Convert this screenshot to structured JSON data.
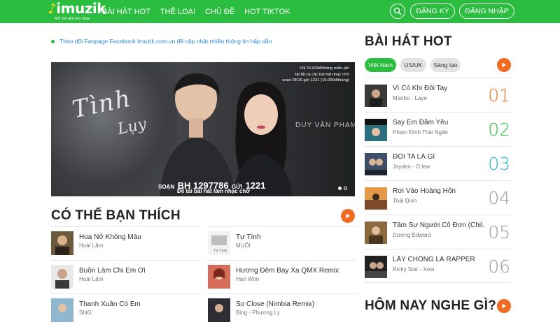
{
  "header": {
    "logo": {
      "word": "imuzik",
      "tagline": "Mở thế giới âm nhạc"
    },
    "nav": [
      "BÀI HÁT HOT",
      "THỂ LOẠI",
      "CHỦ ĐỀ",
      "HOT TIKTOK"
    ],
    "search_icon": "search-icon",
    "register_label": "ĐĂNG KÝ",
    "login_label": "ĐĂNG NHẬP",
    "brand_color": "#2bbd3f"
  },
  "notice": "Theo dõi Fanpage Facebook Imuzik.com.vn để cập nhật nhiều thông tin hấp dẫn",
  "banner": {
    "info_lines": [
      "Chỉ 15.000đ/tháng miễn phí",
      "tải tất cả các bài hát nhạc chờ",
      "soạn DK15 gửi 1221 (15.000đ/tháng)"
    ],
    "script_title_1": "Tình",
    "script_title_2": "Lụy",
    "artist": "DUY VĂN PHẠM",
    "sms_prefix": "SOẠN",
    "sms_code": "BH 1297786",
    "sms_mid": "GỬI",
    "sms_number": "1221",
    "sms_sub": "Để tải bài hát làm nhạc chờ"
  },
  "you_may_like": {
    "title": "CÓ THỂ BẠN THÍCH",
    "left": [
      {
        "title": "Hoa Nở Không Màu",
        "artist": "Hoài Lâm"
      },
      {
        "title": "Buồn Làm Chi Em Ơi",
        "artist": "Hoài Lâm"
      },
      {
        "title": "Thanh Xuân Có Em",
        "artist": "ShiG"
      }
    ],
    "right": [
      {
        "title": "Tự Tình",
        "artist": "MUỐI"
      },
      {
        "title": "Hương Đêm Bay Xa QMX Remix",
        "artist": "Hari Won"
      },
      {
        "title": "So Close (Nimbia Remix)",
        "artist": "Bing - Phương Ly"
      }
    ]
  },
  "hot_songs": {
    "title": "BÀI HÁT HOT",
    "tabs": [
      "Việt Nam",
      "US/UK",
      "Sáng tạo"
    ],
    "items": [
      {
        "title": "Vì Có Khi Đôi Tay",
        "artist": "Manbo - Laye",
        "rank": "01",
        "rank_color": "#f26b22"
      },
      {
        "title": "Say Em Đắm Yêu",
        "artist": "Phạm Đình Thái Ngân",
        "rank": "02",
        "rank_color": "#2bbd3f"
      },
      {
        "title": "ĐÔI TA LÀ GÌ",
        "artist": "Jayden - O.lew",
        "rank": "03",
        "rank_color": "#1fb5c9"
      },
      {
        "title": "Rơi Vào Hoàng Hôn",
        "artist": "Thái Đinh",
        "rank": "04",
        "rank_color": "#999999"
      },
      {
        "title": "Tâm Sự Người Cô Đơn (Chil...",
        "artist": "Dương Edward",
        "rank": "05",
        "rank_color": "#999999"
      },
      {
        "title": "LẤY CHỒNG LÀ RAPPER",
        "artist": "Ricky Star - Xesi",
        "rank": "06",
        "rank_color": "#999999"
      }
    ]
  },
  "today": {
    "title": "HÔM NAY NGHE GÌ?"
  },
  "accent_color": "#f26b22"
}
